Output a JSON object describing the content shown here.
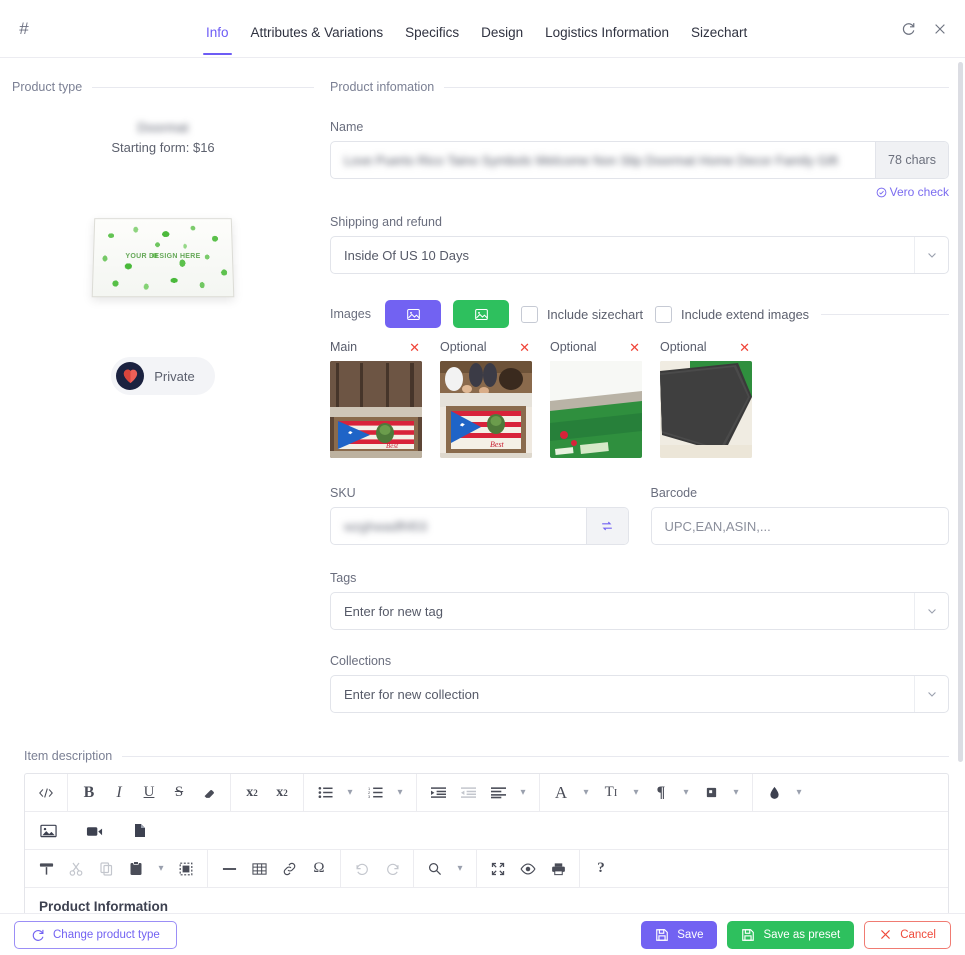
{
  "header": {
    "logo_glyph": "#",
    "tabs": [
      {
        "label": "Info",
        "active": true
      },
      {
        "label": "Attributes & Variations",
        "active": false
      },
      {
        "label": "Specifics",
        "active": false
      },
      {
        "label": "Design",
        "active": false
      },
      {
        "label": "Logistics Information",
        "active": false
      },
      {
        "label": "Sizechart",
        "active": false
      }
    ],
    "refresh_title": "Refresh",
    "close_title": "Close"
  },
  "product_type": {
    "section_title": "Product type",
    "name": "Doormat",
    "starting_price": "Starting form: $16",
    "mockup_text": "YOUR DESIGN HERE",
    "privacy_label": "Private"
  },
  "product_info": {
    "section_title": "Product infomation",
    "name_label": "Name",
    "name_value": "Love Puerto Rico Taino Symbols Welcome Non Slip Doormat Home Decor Family Gift",
    "char_count": "78 chars",
    "vero_check": "Vero check",
    "shipping_label": "Shipping and refund",
    "shipping_value": "Inside Of US 10 Days",
    "images_label": "Images",
    "include_sizechart": "Include sizechart",
    "include_extend_images": "Include extend images",
    "thumbnails": [
      {
        "label": "Main"
      },
      {
        "label": "Optional"
      },
      {
        "label": "Optional"
      },
      {
        "label": "Optional"
      }
    ],
    "sku_label": "SKU",
    "sku_value": "wzghwadfhf03",
    "barcode_label": "Barcode",
    "barcode_placeholder": "UPC,EAN,ASIN,...",
    "tags_label": "Tags",
    "tags_placeholder": "Enter for new tag",
    "collections_label": "Collections",
    "collections_placeholder": "Enter for new collection"
  },
  "item_description": {
    "section_title": "Item description",
    "body_heading": "Product Information",
    "toolbar_row1": [
      "source-code-icon",
      "bold-icon",
      "italic-icon",
      "underline-icon",
      "strikethrough-icon",
      "remove-format-icon",
      "superscript-icon",
      "subscript-icon",
      "bulleted-list-icon",
      "numbered-list-icon",
      "indent-increase-icon",
      "indent-decrease-icon",
      "align-icon",
      "font-icon",
      "font-size-icon",
      "paragraph-format-icon",
      "text-color-icon",
      "background-color-icon"
    ],
    "toolbar_row2": [
      "insert-image-icon",
      "insert-video-icon",
      "insert-file-icon"
    ],
    "toolbar_row3": [
      "format-painter-icon",
      "cut-icon",
      "copy-icon",
      "paste-icon",
      "select-all-icon",
      "horizontal-rule-icon",
      "table-icon",
      "link-icon",
      "special-character-icon",
      "undo-icon",
      "redo-icon",
      "find-replace-icon",
      "fullscreen-icon",
      "preview-icon",
      "print-icon",
      "help-icon"
    ]
  },
  "footer": {
    "change_product_type": "Change product type",
    "save": "Save",
    "save_as_preset": "Save as preset",
    "cancel": "Cancel"
  },
  "colors": {
    "accent_purple": "#7262f2",
    "accent_green": "#2ec05e",
    "danger_red": "#ef4b3c",
    "text": "#3d4150",
    "muted": "#8b8f9c"
  }
}
